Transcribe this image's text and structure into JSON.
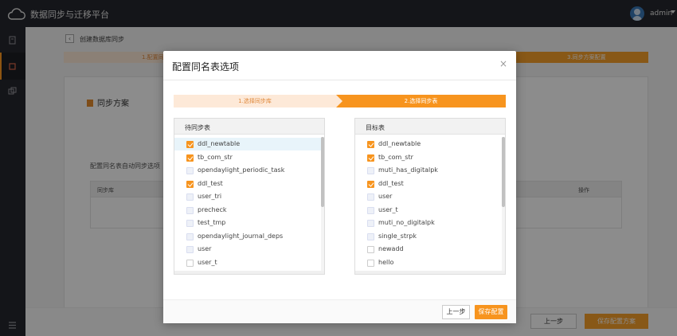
{
  "app": {
    "title": "数据同步与迁移平台",
    "user": "admin"
  },
  "page": {
    "breadcrumb": "创建数据库同步",
    "steps": [
      "1.配置同",
      "3.同步方案配置"
    ],
    "card_title": "同步方案",
    "auto_label": "配置同名表自动同步选项",
    "table_headers": [
      "同步库",
      "操作"
    ],
    "prev_button": "上一步",
    "save_button": "保存配置方案"
  },
  "modal": {
    "title": "配置同名表选项",
    "close_icon": "×",
    "steps": [
      "1.选择同步库",
      "2.选择同步表"
    ],
    "active_step": 2,
    "left_panel": {
      "header": "待同步表",
      "items": [
        {
          "label": "ddl_newtable",
          "state": "checked"
        },
        {
          "label": "tb_com_str",
          "state": "checked"
        },
        {
          "label": "opendaylight_periodic_task",
          "state": "tint"
        },
        {
          "label": "ddl_test",
          "state": "checked"
        },
        {
          "label": "user_tri",
          "state": "tint"
        },
        {
          "label": "precheck",
          "state": "tint"
        },
        {
          "label": "test_tmp",
          "state": "tint"
        },
        {
          "label": "opendaylight_journal_deps",
          "state": "tint"
        },
        {
          "label": "user",
          "state": "tint"
        },
        {
          "label": "user_t",
          "state": "unchecked"
        }
      ]
    },
    "right_panel": {
      "header": "目标表",
      "items": [
        {
          "label": "ddl_newtable",
          "state": "checked"
        },
        {
          "label": "tb_com_str",
          "state": "checked"
        },
        {
          "label": "muti_has_digitalpk",
          "state": "tint"
        },
        {
          "label": "ddl_test",
          "state": "checked"
        },
        {
          "label": "user",
          "state": "tint"
        },
        {
          "label": "user_t",
          "state": "tint"
        },
        {
          "label": "muti_no_digitalpk",
          "state": "tint"
        },
        {
          "label": "single_strpk",
          "state": "tint"
        },
        {
          "label": "newadd",
          "state": "unchecked"
        },
        {
          "label": "hello",
          "state": "unchecked"
        }
      ]
    },
    "prev_button": "上一步",
    "save_button": "保存配置"
  },
  "colors": {
    "accent": "#f7941e",
    "topbar": "#26272e",
    "step_inactive": "#fde9d8"
  }
}
